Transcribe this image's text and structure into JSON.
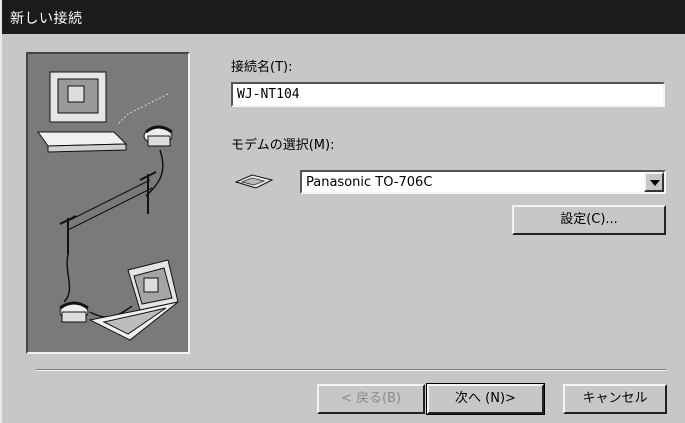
{
  "window": {
    "title": "新しい接続"
  },
  "connection_name": {
    "label": "接続名(T):",
    "value": "WJ-NT104"
  },
  "modem": {
    "label": "モデムの選択(M):",
    "selected": "Panasonic TO-706C",
    "icon": "modem-icon"
  },
  "buttons": {
    "settings": "設定(C)...",
    "back": "< 戻る(B)",
    "next": "次へ (N)>",
    "cancel": "キャンセル"
  },
  "illustration": {
    "icon": "computer-phone-connection-illustration"
  },
  "colors": {
    "titlebar": "#1b1b1b",
    "dialog": "#c7c7c7",
    "panel": "#7a7a7a"
  }
}
